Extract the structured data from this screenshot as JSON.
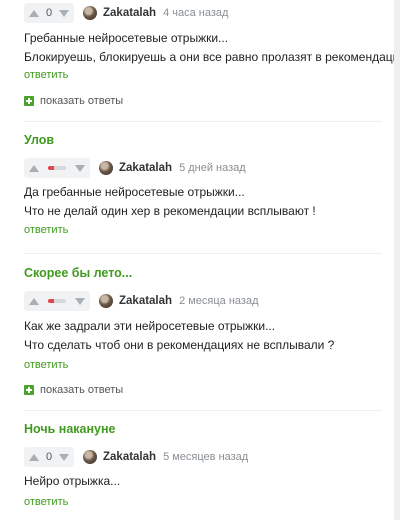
{
  "comments": [
    {
      "score": "0",
      "author": "Zakatalah",
      "time": "4 часа назад",
      "lines": [
        "Гребанные нейросетевые отрыжки...",
        "Блокируешь, блокируешь а они все равно пролазят в рекомендации."
      ],
      "reply": "ответить",
      "show_replies": "показать ответы"
    },
    {
      "post_title": "Улов",
      "rating_negative_fraction": 0.35,
      "author": "Zakatalah",
      "time": "5 дней назад",
      "lines": [
        "Да гребанные нейросетевые отрыжки...",
        "Что не делай один хер в рекомендации всплывают !"
      ],
      "reply": "ответить"
    },
    {
      "post_title": "Скорее бы лето...",
      "rating_negative_fraction": 0.35,
      "author": "Zakatalah",
      "time": "2 месяца назад",
      "lines": [
        "Как же задрали эти нейросетевые отрыжки...",
        "Что сделать чтоб они в рекомендациях не всплывали ?"
      ],
      "reply": "ответить",
      "show_replies": "показать ответы"
    },
    {
      "post_title": "Ночь накануне",
      "score": "0",
      "author": "Zakatalah",
      "time": "5 месяцев назад",
      "lines": [
        "Нейро отрыжка..."
      ],
      "reply": "ответить"
    }
  ],
  "colors": {
    "accent": "#3f9a1e",
    "negative": "#e0464b"
  }
}
